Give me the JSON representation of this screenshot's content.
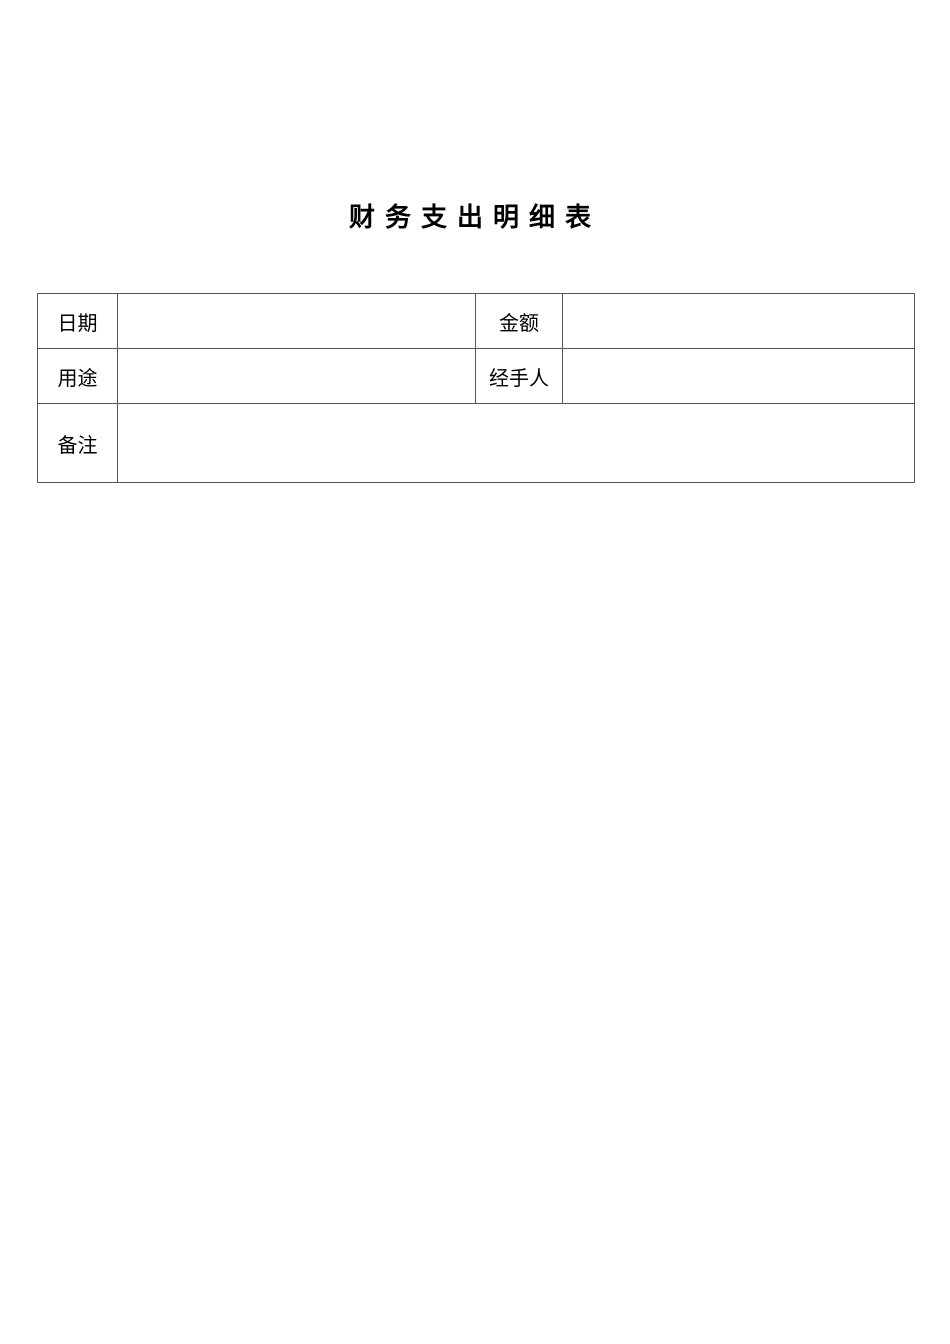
{
  "document": {
    "title": "财务支出明细表"
  },
  "form": {
    "date": {
      "label": "日期",
      "value": ""
    },
    "amount": {
      "label": "金额",
      "value": ""
    },
    "purpose": {
      "label": "用途",
      "value": ""
    },
    "handler": {
      "label": "经手人",
      "value": ""
    },
    "remarks": {
      "label": "备注",
      "value": ""
    }
  }
}
